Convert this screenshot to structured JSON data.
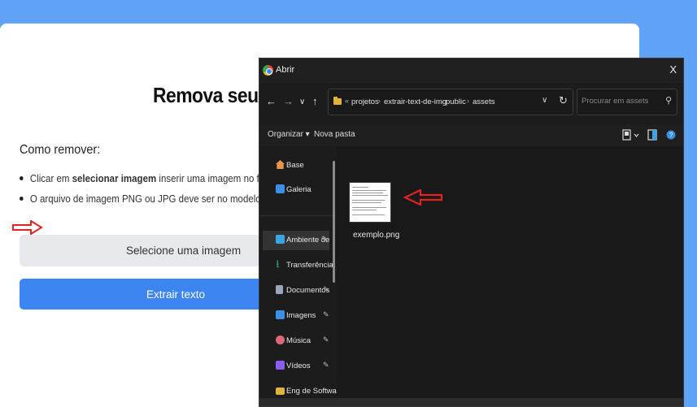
{
  "page": {
    "title": "Remova seu tex",
    "how_title": "Como remover:",
    "bullets": [
      {
        "prefix": "Clicar em ",
        "bold": "selecionar imagem",
        "suffix": " inserir uma imagem no formato PN"
      },
      {
        "text": "O arquivo de imagem PNG ou JPG deve ser no modelo de prints"
      }
    ],
    "select_button": "Selecione uma imagem",
    "extract_button": "Extrair texto"
  },
  "dialog": {
    "title": "Abrir",
    "close": "X",
    "breadcrumb_prefix": "«",
    "breadcrumb": [
      "projetos",
      "extrair-text-de-img",
      "public",
      "assets"
    ],
    "search_placeholder": "Procurar em assets",
    "commands": {
      "organize": "Organizar ▾",
      "new_folder": "Nova pasta"
    },
    "sidebar": [
      {
        "label": "Base",
        "icon": "home-icon",
        "color": "#e6954a"
      },
      {
        "label": "Galeria",
        "icon": "gallery-icon",
        "color": "#3b8fe6"
      },
      {
        "label": "Ambiente de",
        "icon": "desktop-icon",
        "color": "#3ba6e6",
        "pinned": true
      },
      {
        "label": "Transferência",
        "icon": "download-icon",
        "color": "#2fa37a",
        "pinned": true
      },
      {
        "label": "Documentos",
        "icon": "documents-icon",
        "color": "#9aa7b8",
        "pinned": true
      },
      {
        "label": "Imagens",
        "icon": "pictures-icon",
        "color": "#3b8fe6",
        "pinned": true
      },
      {
        "label": "Música",
        "icon": "music-icon",
        "color": "#e0677a",
        "pinned": true
      },
      {
        "label": "Vídeos",
        "icon": "videos-icon",
        "color": "#8b5cf6",
        "pinned": true
      },
      {
        "label": "Eng de Software",
        "icon": "folder-icon",
        "color": "#e2b33b"
      }
    ],
    "files": [
      {
        "name": "exemplo.png"
      }
    ]
  },
  "colors": {
    "background": "#60a3f6",
    "primary_button": "#3d86f2",
    "dialog_bg": "#1c1c1c",
    "annotation_arrow": "#e02424"
  }
}
